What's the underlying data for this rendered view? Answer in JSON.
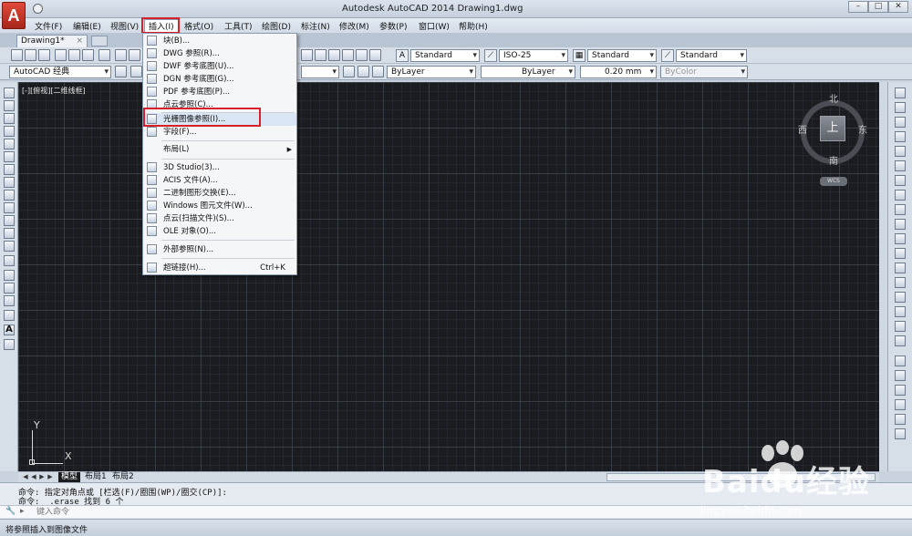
{
  "window": {
    "title": "Autodesk AutoCAD 2014    Drawing1.dwg",
    "logo_letter": "A"
  },
  "menubar": {
    "items": [
      "文件(F)",
      "编辑(E)",
      "视图(V)",
      "插入(I)",
      "格式(O)",
      "工具(T)",
      "绘图(D)",
      "标注(N)",
      "修改(M)",
      "参数(P)",
      "窗口(W)",
      "帮助(H)"
    ]
  },
  "doc_tab": {
    "label": "Drawing1*",
    "close": "×"
  },
  "toolbar": {
    "text_style": "Standard",
    "dim_style": "ISO-25",
    "table_style": "Standard",
    "mleader_style": "Standard",
    "workspace": "AutoCAD 经典",
    "layer": "ByLayer",
    "linetype": "ByLayer",
    "lineweight": "0.20 mm",
    "plot_style": "ByColor"
  },
  "insert_menu": {
    "items": [
      {
        "label": "块(B)...",
        "shortcut": ""
      },
      {
        "label": "DWG 参照(R)...",
        "shortcut": ""
      },
      {
        "label": "DWF 参考底图(U)...",
        "shortcut": ""
      },
      {
        "label": "DGN 参考底图(G)...",
        "shortcut": ""
      },
      {
        "label": "PDF 参考底图(P)...",
        "shortcut": ""
      },
      {
        "label": "点云参照(C)...",
        "shortcut": ""
      },
      {
        "label": "光栅图像参照(I)...",
        "shortcut": ""
      },
      {
        "label": "字段(F)...",
        "shortcut": ""
      },
      {
        "label": "布局(L)",
        "shortcut": ""
      },
      {
        "label": "3D Studio(3)...",
        "shortcut": ""
      },
      {
        "label": "ACIS 文件(A)...",
        "shortcut": ""
      },
      {
        "label": "二进制图形交换(E)...",
        "shortcut": ""
      },
      {
        "label": "Windows 图元文件(W)...",
        "shortcut": ""
      },
      {
        "label": "点云(扫描文件)(S)...",
        "shortcut": ""
      },
      {
        "label": "OLE 对象(O)...",
        "shortcut": ""
      },
      {
        "label": "外部参照(N)...",
        "shortcut": ""
      },
      {
        "label": "超链接(H)...",
        "shortcut": "Ctrl+K"
      }
    ]
  },
  "canvas": {
    "viewport_label": "[-][俯视][二维线框]",
    "ucs_y": "Y",
    "ucs_x": "X"
  },
  "viewcube": {
    "face": "上",
    "north": "北",
    "south": "南",
    "east": "东",
    "west": "西",
    "wcs": "WCS"
  },
  "layout_tabs": [
    "模型",
    "布局1",
    "布局2"
  ],
  "command": {
    "history": [
      "命令: 指定对角点或 [栏选(F)/圈围(WP)/圈交(CP)]:",
      "命令: _.erase 找到 6 个"
    ],
    "placeholder": "键入命令"
  },
  "status": {
    "text": "将参照插入到图像文件"
  },
  "watermark": {
    "brand": "Baidu经验",
    "site": "jingyan.baidu.com"
  },
  "colors": {
    "highlight_red": "#d8202a",
    "canvas_bg": "#1a1c20"
  }
}
